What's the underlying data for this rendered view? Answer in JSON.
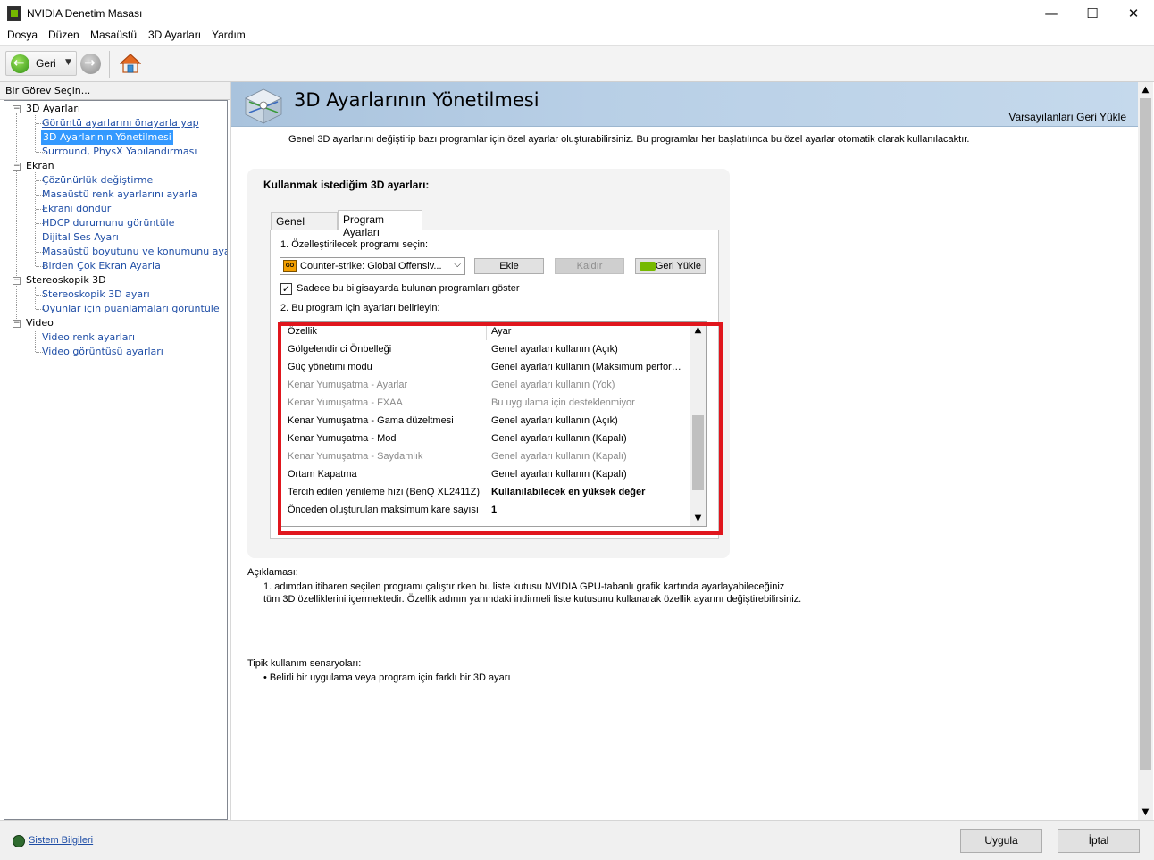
{
  "window": {
    "title": "NVIDIA Denetim Masası",
    "minimize_glyph": "—",
    "maximize_glyph": "☐",
    "close_glyph": "✕"
  },
  "menu": [
    "Dosya",
    "Düzen",
    "Masaüstü",
    "3D Ayarları",
    "Yardım"
  ],
  "toolbar": {
    "back_label": "Geri",
    "dropdown_glyph": "▼"
  },
  "task_panel": {
    "header": "Bir Görev Seçin...",
    "expander_glyph": "−"
  },
  "tree": {
    "cat_3d": "3D Ayarları",
    "item_preview": "Görüntü ayarlarını önayarla yap",
    "item_manage3d": "3D Ayarlarının Yönetilmesi",
    "item_surround": "Surround, PhysX Yapılandırması",
    "cat_display": "Ekran",
    "item_resolution": "Çözünürlük değiştirme",
    "item_color": "Masaüstü renk ayarlarını ayarla",
    "item_rotate": "Ekranı döndür",
    "item_hdcp": "HDCP durumunu görüntüle",
    "item_audio": "Dijital Ses Ayarı",
    "item_desktop_size": "Masaüstü boyutunu ve konumunu ayarla",
    "item_multi": "Birden Çok Ekran Ayarla",
    "cat_stereo": "Stereoskopik 3D",
    "item_stereo_setup": "Stereoskopik 3D ayarı",
    "item_ratings": "Oyunlar için puanlamaları görüntüle",
    "cat_video": "Video",
    "item_video_color": "Video renk ayarları",
    "item_video_image": "Video görüntüsü ayarları"
  },
  "page": {
    "title": "3D Ayarlarının Yönetilmesi",
    "restore_defaults": "Varsayılanları Geri Yükle",
    "intro": "Genel 3D ayarlarını değiştirip bazı programlar için özel ayarlar oluşturabilirsiniz. Bu programlar her başlatılınca bu özel ayarlar otomatik olarak kullanılacaktır.",
    "settings_heading": "Kullanmak istediğim 3D ayarları:",
    "tab_general": "Genel Ayarlar",
    "tab_program": "Program Ayarları",
    "step1": "1. Özelleştirilecek programı seçin:",
    "program_selected": "Counter-strike: Global Offensiv...",
    "program_icon_text": "GO",
    "select_chevron": "⌵",
    "add_button": "Ekle",
    "remove_button": "Kaldır",
    "restore_button": "Geri Yükle",
    "checkbox_checked": "✓",
    "checkbox_label": "Sadece bu bilgisayarda bulunan programları göster",
    "step2": "2. Bu program için ayarları belirleyin:",
    "list_header": {
      "feature": "Özellik",
      "setting": "Ayar"
    },
    "scroll_up": "▲",
    "scroll_down": "▼",
    "list_rows": [
      {
        "feature": "Gölgelendirici Önbelleği",
        "setting": "Genel ayarları kullanın (Açık)"
      },
      {
        "feature": "Güç yönetimi modu",
        "setting": "Genel ayarları kullanın (Maksimum performans tercih edin)"
      },
      {
        "feature": "Kenar Yumuşatma - Ayarlar",
        "setting": "Genel ayarları kullanın (Yok)"
      },
      {
        "feature": "Kenar Yumuşatma - FXAA",
        "setting": "Bu uygulama için desteklenmiyor"
      },
      {
        "feature": "Kenar Yumuşatma - Gama düzeltmesi",
        "setting": "Genel ayarları kullanın (Açık)"
      },
      {
        "feature": "Kenar Yumuşatma - Mod",
        "setting": "Genel ayarları kullanın (Kapalı)"
      },
      {
        "feature": "Kenar Yumuşatma - Saydamlık",
        "setting": "Genel ayarları kullanın (Kapalı)"
      },
      {
        "feature": "Ortam Kapatma",
        "setting": "Genel ayarları kullanın (Kapalı)"
      },
      {
        "feature": "Tercih edilen yenileme hızı (BenQ XL2411Z)",
        "setting": "Kullanılabilecek en yüksek değer"
      },
      {
        "feature": "Önceden oluşturulan maksimum kare sayısı",
        "setting": "1"
      }
    ],
    "desc_label": "Açıklaması:",
    "desc_line1": "1. adımdan itibaren seçilen programı çalıştırırken bu liste kutusu NVIDIA GPU-tabanlı grafik kartında ayarlayabileceğiniz",
    "desc_line2": "tüm 3D özelliklerini içermektedir. Özellik adının yanındaki indirmeli liste kutusunu kullanarak özellik ayarını değiştirebilirsiniz.",
    "usage_label": "Tipik kullanım senaryoları:",
    "usage_item": "• Belirli bir uygulama veya program için farklı bir 3D ayarı"
  },
  "bottom": {
    "system_info": "Sistem Bilgileri",
    "apply": "Uygula",
    "cancel": "İptal"
  },
  "colors": {
    "accent": "#76b900",
    "highlight": "#e0161d",
    "selection": "#3399ff",
    "link": "#1f4ea6"
  }
}
